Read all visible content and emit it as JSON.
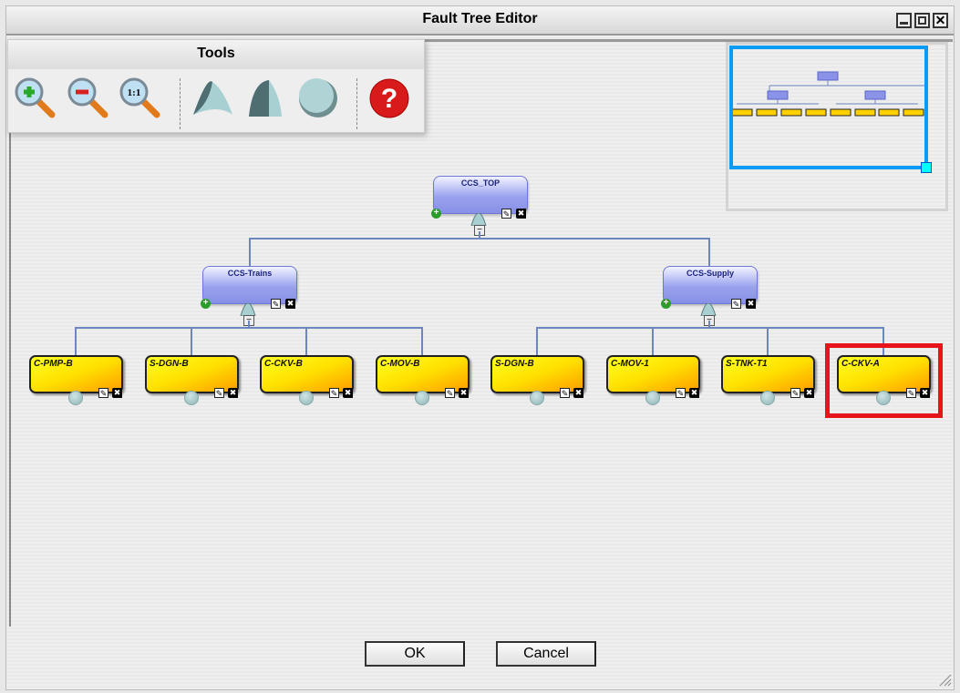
{
  "window": {
    "title": "Fault Tree Editor",
    "controls": [
      "minimize",
      "maximize",
      "close"
    ]
  },
  "tools": {
    "title": "Tools",
    "items": [
      {
        "name": "zoom-in-icon",
        "label": ""
      },
      {
        "name": "zoom-out-icon",
        "label": ""
      },
      {
        "name": "zoom-actual-icon",
        "label": "1:1"
      },
      {
        "name": "and-gate-icon"
      },
      {
        "name": "or-gate-icon"
      },
      {
        "name": "basic-event-icon"
      },
      {
        "name": "help-icon",
        "label": "?"
      }
    ]
  },
  "tree": {
    "label": "CCS_TOP",
    "children": [
      {
        "label": "CCS-Trains",
        "children": [
          "C-PMP-B",
          "S-DGN-B",
          "C-CKV-B",
          "C-MOV-B"
        ]
      },
      {
        "label": "CCS-Supply",
        "children": [
          "S-DGN-B",
          "C-MOV-1",
          "S-TNK-T1",
          "C-CKV-A"
        ]
      }
    ]
  },
  "highlighted_node": "C-CKV-A",
  "colors": {
    "highlight": "#e8141c",
    "viewport": "#0a9cf5",
    "gate": "#9aa2ee",
    "event": "#ffd000"
  },
  "buttons": {
    "ok": "OK",
    "cancel": "Cancel"
  }
}
